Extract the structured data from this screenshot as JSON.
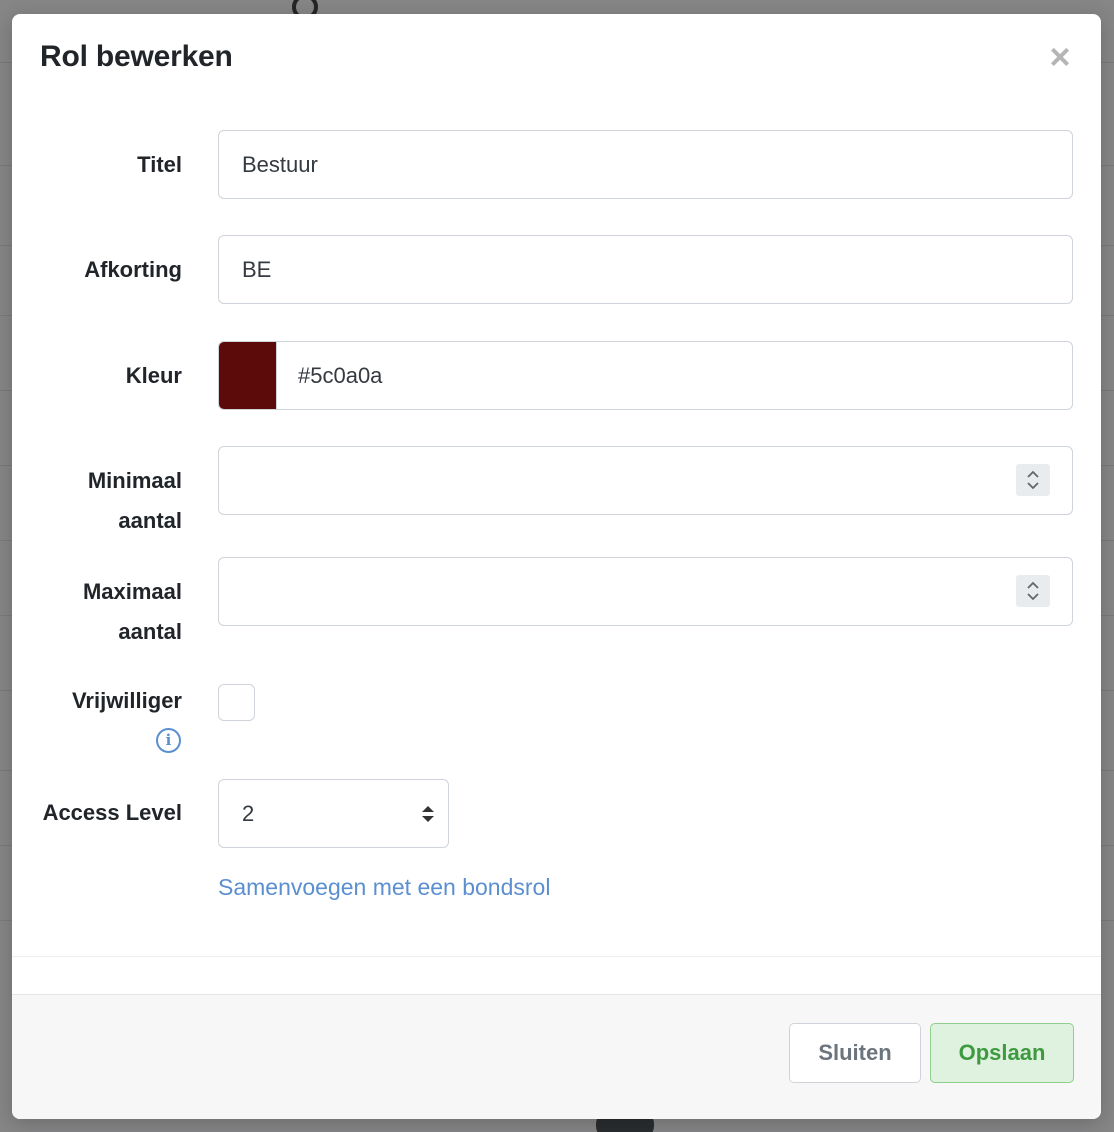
{
  "modal": {
    "title": "Rol bewerken",
    "close_symbol": "×"
  },
  "form": {
    "title_label": "Titel",
    "title_value": "Bestuur",
    "abbr_label": "Afkorting",
    "abbr_value": "BE",
    "color_label": "Kleur",
    "color_value": "#5c0a0a",
    "color_swatch": "#5c0a0a",
    "min_label_line1": "Minimaal",
    "min_label_line2": "aantal",
    "min_value": "",
    "max_label_line1": "Maximaal",
    "max_label_line2": "aantal",
    "max_value": "",
    "volunteer_label": "Vrijwilliger",
    "volunteer_checked": false,
    "access_label": "Access Level",
    "access_value": "2",
    "merge_link": "Samenvoegen met een bondsrol"
  },
  "footer": {
    "close_label": "Sluiten",
    "save_label": "Opslaan"
  },
  "icons": {
    "close": "close-icon",
    "info": "info-icon",
    "spinner": "spinner-icon",
    "select_arrows": "select-arrows-icon"
  }
}
